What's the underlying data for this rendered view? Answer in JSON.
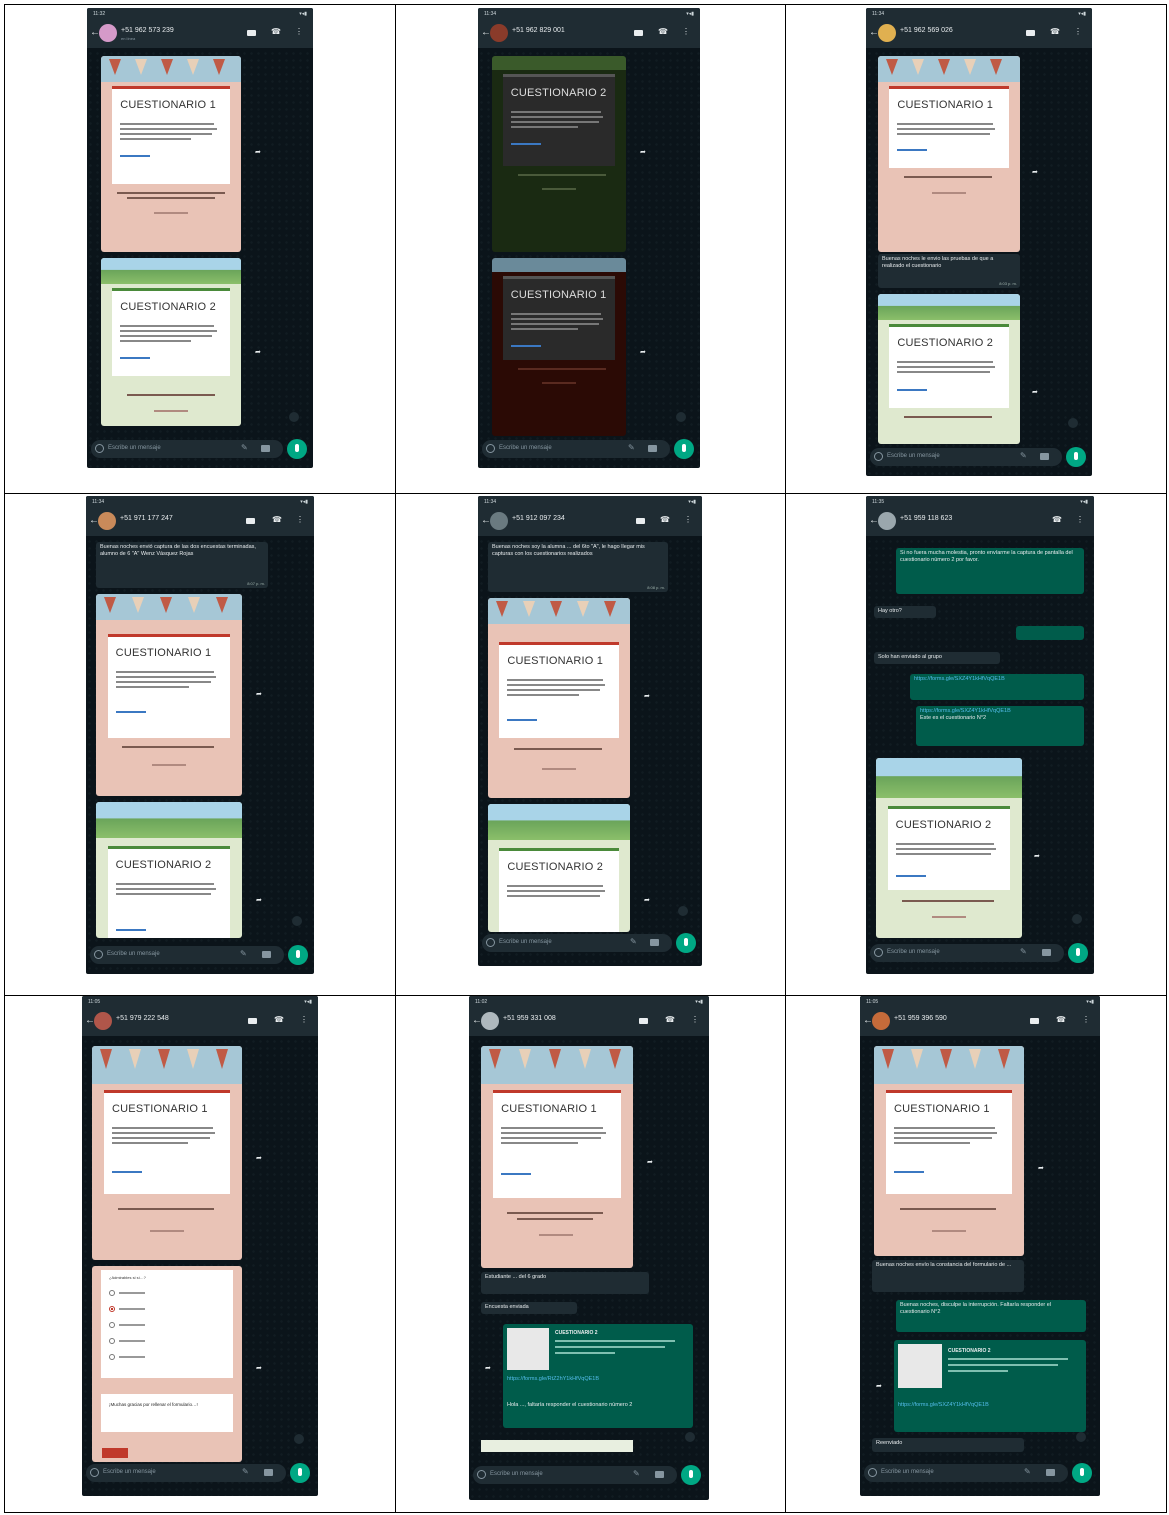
{
  "composer_placeholder": "Escribe un mensaje",
  "form_titles": {
    "q1": "CUESTIONARIO 1",
    "q2": "CUESTIONARIO 2"
  },
  "phones": [
    {
      "time": "11:32",
      "number": "+51 962 573 239",
      "sub": "en línea"
    },
    {
      "time": "11:34",
      "number": "+51 962 829 001",
      "sub": ""
    },
    {
      "time": "11:34",
      "number": "+51 962 569 026",
      "sub": ""
    },
    {
      "time": "11:34",
      "number": "+51 971 177 247",
      "sub": ""
    },
    {
      "time": "11:34",
      "number": "+51 912 097 234",
      "sub": ""
    },
    {
      "time": "11:35",
      "number": "+51 959 118 623",
      "sub": ""
    },
    {
      "time": "11:05",
      "number": "+51 979 222 548",
      "sub": ""
    },
    {
      "time": "11:02",
      "number": "+51 959 331 008",
      "sub": ""
    },
    {
      "time": "11:05",
      "number": "+51 959 396 590",
      "sub": ""
    }
  ],
  "messages": {
    "p3_msg": "Buenas noches le envio las pruebas de que a realizado el cuestionario",
    "p3_time": "8:03 p. m.",
    "p4_msg": "Buenas noches envió captura de las dos encuestas terminadas, alumno de 6 \"A\" Wenz Vásquez Rojas",
    "p4_time": "8:07 p. m.",
    "p5_msg": "Buenas noches soy la alumna ... del 6to \"A\", le hago llegar mis capturas con los cuestionarios realizados",
    "p5_time": "8:08 p. m.",
    "p6_a": "Si no fuera mucha molestia, pronto envíarme la captura de pantalla del cuestionario número 2 por favor.",
    "p6_b": "Hay otro?",
    "p6_c": "Solo han enviado al grupo",
    "p6_link": "https://forms.gle/SXZ4Y1kHfVqQE1B",
    "p6_d": "Este es el cuestionario N°2",
    "p8_a": "Estudiante ... del 6 grado",
    "p8_b": "Encuesta enviada",
    "p8_card_title": "CUESTIONARIO 2",
    "p8_link": "https://forms.gle/RtZ2hY1kHfVqQE1B",
    "p8_c": "Hola ..., faltaría responder el cuestionario número 2",
    "p9_a": "Buenas noches envío la constancia del formulario de ...",
    "p9_b": "Buenas noches, disculpe la interrupción. Faltaría responder el cuestionario N°2",
    "p9_card_title": "CUESTIONARIO 2",
    "p9_link": "https://forms.gle/SXZ4Y1kHfVqQE1B",
    "p9_fwd": "Reenviado"
  },
  "survey": {
    "question": "¿Admirables si sí…?",
    "thanks": "¡Muchas gracias por rellenar el formulario…!"
  }
}
